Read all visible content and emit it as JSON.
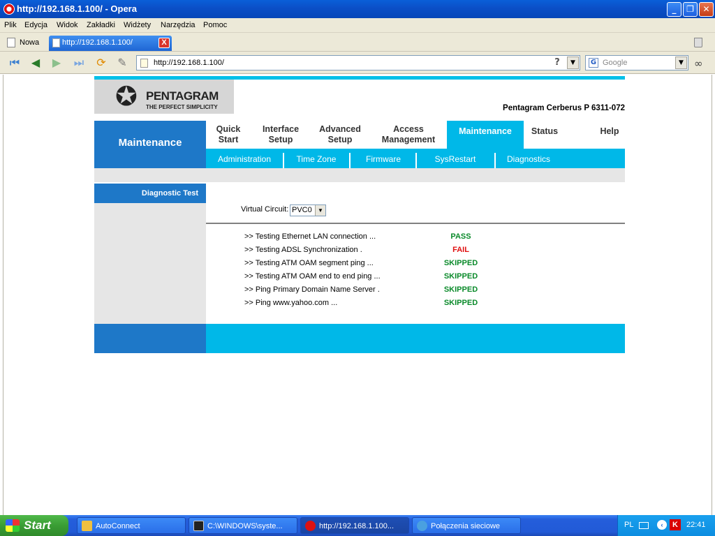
{
  "window": {
    "title": "http://192.168.1.100/ - Opera",
    "minimize": "_",
    "maximize": "❐",
    "close": "✕"
  },
  "menu": [
    "Plik",
    "Edycja",
    "Widok",
    "Zakładki",
    "Widżety",
    "Narzędzia",
    "Pomoc"
  ],
  "tabs": {
    "new_tab_label": "Nowa",
    "active_tab_title": "http://192.168.1.100/",
    "close_glyph": "X"
  },
  "address": {
    "url": "http://192.168.1.100/",
    "help": "?",
    "search_placeholder": "Google",
    "search_engine_letter": "G"
  },
  "router": {
    "brand": "PENTAGRAM",
    "tagline": "THE PERFECT SIMPLICITY",
    "model": "Pentagram Cerberus P 6311-072",
    "section_title": "Maintenance",
    "nav": [
      {
        "label_line1": "Quick",
        "label_line2": "Start",
        "active": false
      },
      {
        "label_line1": "Interface",
        "label_line2": "Setup",
        "active": false
      },
      {
        "label_line1": "Advanced",
        "label_line2": "Setup",
        "active": false
      },
      {
        "label_line1": "Access",
        "label_line2": "Management",
        "active": false
      },
      {
        "label": "Maintenance",
        "active": true
      },
      {
        "label": "Status",
        "active": false
      },
      {
        "label": "Help",
        "active": false
      }
    ],
    "subnav": [
      "Administration",
      "Time Zone",
      "Firmware",
      "SysRestart",
      "Diagnostics"
    ],
    "left_label": "Diagnostic Test",
    "virtual_circuit": {
      "label": "Virtual Circuit:",
      "value": "PVC0"
    },
    "tests": [
      {
        "name": ">> Testing Ethernet LAN connection ...",
        "status": "PASS"
      },
      {
        "name": ">> Testing ADSL Synchronization .",
        "status": "FAIL"
      },
      {
        "name": ">> Testing ATM OAM segment ping ...",
        "status": "SKIPPED"
      },
      {
        "name": ">> Testing ATM OAM end to end ping ...",
        "status": "SKIPPED"
      },
      {
        "name": ">> Ping Primary Domain Name Server .",
        "status": "SKIPPED"
      },
      {
        "name": ">> Ping www.yahoo.com ...",
        "status": "SKIPPED"
      }
    ]
  },
  "taskbar": {
    "start_label": "Start",
    "tasks": [
      {
        "label": "AutoConnect",
        "active": false
      },
      {
        "label": "C:\\WINDOWS\\syste...",
        "active": false
      },
      {
        "label": "http://192.168.1.100...",
        "active": true
      },
      {
        "label": "Połączenia sieciowe",
        "active": false
      }
    ],
    "tray": {
      "language": "PL",
      "kaspersky": "K",
      "time": "22:41"
    }
  },
  "colors": {
    "router_dark_blue": "#1e78c8",
    "router_cyan": "#00b8e8",
    "pass": "#0a8a2a",
    "fail": "#e01010"
  }
}
